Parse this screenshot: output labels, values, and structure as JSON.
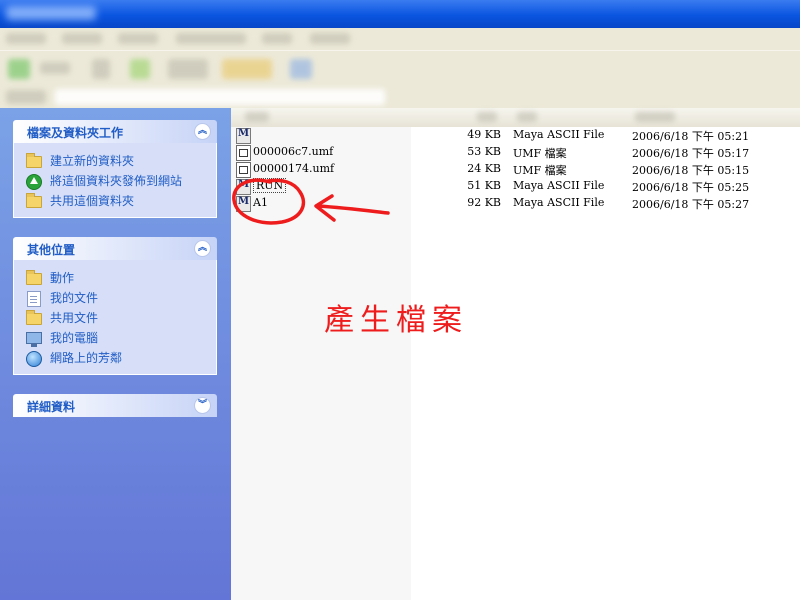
{
  "taskpane": {
    "panels": [
      {
        "title": "檔案及資料夾工作",
        "items": [
          {
            "label": "建立新的資料夾",
            "icon": "new-folder-icon"
          },
          {
            "label": "將這個資料夾發佈到網站",
            "icon": "publish-web-icon"
          },
          {
            "label": "共用這個資料夾",
            "icon": "share-folder-icon"
          }
        ]
      },
      {
        "title": "其他位置",
        "items": [
          {
            "label": "動作",
            "icon": "folder-icon"
          },
          {
            "label": "我的文件",
            "icon": "my-documents-icon"
          },
          {
            "label": "共用文件",
            "icon": "shared-documents-icon"
          },
          {
            "label": "我的電腦",
            "icon": "my-computer-icon"
          },
          {
            "label": "網路上的芳鄰",
            "icon": "network-places-icon"
          }
        ]
      },
      {
        "title": "詳細資料",
        "items": []
      }
    ]
  },
  "files": [
    {
      "name": "",
      "size": "49 KB",
      "type": "Maya ASCII File",
      "date": "2006/6/18 下午 05:21",
      "icon": "maya-file-icon"
    },
    {
      "name": "000006c7.umf",
      "size": "53 KB",
      "type": "UMF 檔案",
      "date": "2006/6/18 下午 05:17",
      "icon": "umf-file-icon"
    },
    {
      "name": "00000174.umf",
      "size": "24 KB",
      "type": "UMF 檔案",
      "date": "2006/6/18 下午 05:15",
      "icon": "umf-file-icon"
    },
    {
      "name": "RUN",
      "size": "51 KB",
      "type": "Maya ASCII File",
      "date": "2006/6/18 下午 05:25",
      "icon": "maya-file-icon"
    },
    {
      "name": "A1",
      "size": "92 KB",
      "type": "Maya ASCII File",
      "date": "2006/6/18 下午 05:27",
      "icon": "maya-file-icon"
    }
  ],
  "annotation": {
    "text": "產生檔案",
    "color": "#ee1c1c"
  },
  "colors": {
    "taskpane_top": "#7ba2e7",
    "taskpane_bottom": "#6375d6",
    "panel_title": "#215dc6",
    "titlebar": "#0a55e0"
  }
}
